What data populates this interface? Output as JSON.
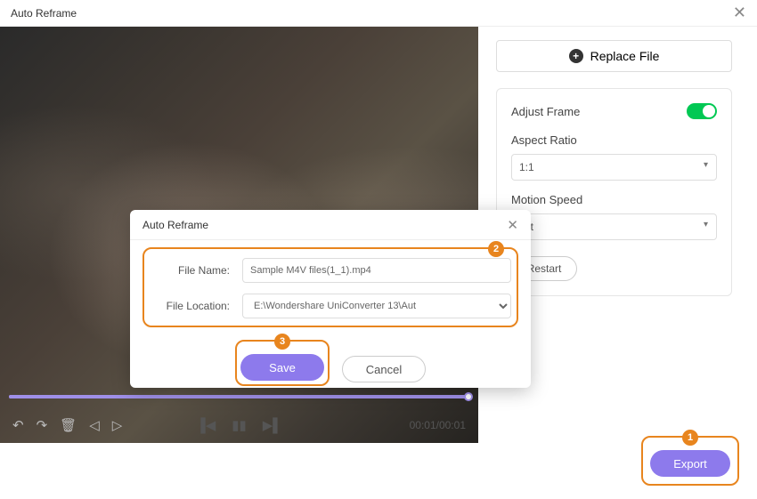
{
  "header": {
    "title": "Auto Reframe"
  },
  "sidebar": {
    "replace_label": "Replace File",
    "adjust_frame_label": "Adjust Frame",
    "aspect_ratio_label": "Aspect Ratio",
    "aspect_ratio_value": "1:1",
    "motion_speed_label": "Motion Speed",
    "motion_speed_value": "ast",
    "restart_label": "Restart"
  },
  "player": {
    "time": "00:01/00:01"
  },
  "modal": {
    "title": "Auto Reframe",
    "filename_label": "File Name:",
    "filename_value": "Sample M4V files(1_1).mp4",
    "location_label": "File Location:",
    "location_value": "E:\\Wondershare UniConverter 13\\Aut",
    "save_label": "Save",
    "cancel_label": "Cancel"
  },
  "footer": {
    "export_label": "Export"
  },
  "markers": {
    "one": "1",
    "two": "2",
    "three": "3"
  }
}
